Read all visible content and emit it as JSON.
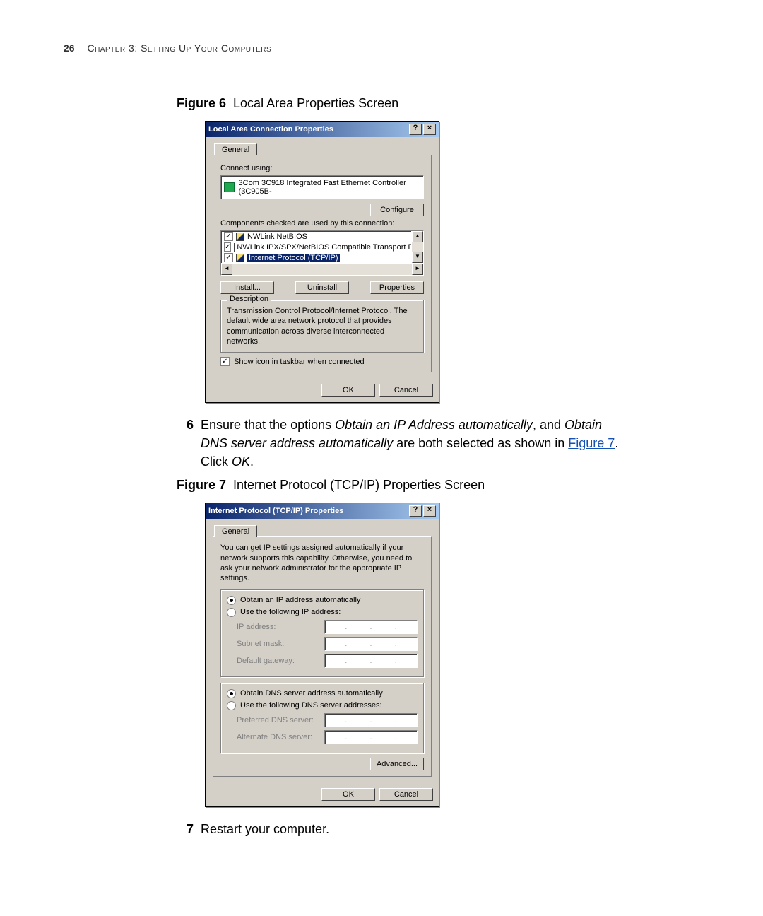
{
  "page": {
    "number": "26",
    "chapter": "Chapter 3: Setting Up Your Computers"
  },
  "fig6": {
    "label": "Figure 6",
    "caption": "Local Area Properties Screen"
  },
  "dlg1": {
    "title": "Local Area Connection Properties",
    "help": "?",
    "close": "×",
    "tab": "General",
    "connect_using": "Connect using:",
    "adapter": "3Com 3C918 Integrated Fast Ethernet Controller (3C905B-",
    "configure": "Configure",
    "components_label": "Components checked are used by this connection:",
    "items": [
      "NWLink NetBIOS",
      "NWLink IPX/SPX/NetBIOS Compatible Transport Proto",
      "Internet Protocol (TCP/IP)"
    ],
    "install": "Install...",
    "uninstall": "Uninstall",
    "properties": "Properties",
    "description_legend": "Description",
    "description": "Transmission Control Protocol/Internet Protocol. The default wide area network protocol that provides communication across diverse interconnected networks.",
    "show_icon": "Show icon in taskbar when connected",
    "ok": "OK",
    "cancel": "Cancel"
  },
  "step6": {
    "num": "6",
    "t1": "Ensure that the options ",
    "i1": "Obtain an IP Address automatically",
    "t2": ", and ",
    "i2": "Obtain DNS server address automatically",
    "t3": " are both selected as shown in ",
    "link": "Figure 7",
    "t4": ". Click ",
    "i3": "OK",
    "t5": "."
  },
  "fig7": {
    "label": "Figure 7",
    "caption": "Internet Protocol (TCP/IP) Properties Screen"
  },
  "dlg2": {
    "title": "Internet Protocol (TCP/IP) Properties",
    "help": "?",
    "close": "×",
    "tab": "General",
    "intro": "You can get IP settings assigned automatically if your network supports this capability. Otherwise, you need to ask your network administrator for the appropriate IP settings.",
    "r_obtain_ip": "Obtain an IP address automatically",
    "r_use_ip": "Use the following IP address:",
    "f_ip": "IP address:",
    "f_subnet": "Subnet mask:",
    "f_gateway": "Default gateway:",
    "r_obtain_dns": "Obtain DNS server address automatically",
    "r_use_dns": "Use the following DNS server addresses:",
    "f_pref_dns": "Preferred DNS server:",
    "f_alt_dns": "Alternate DNS server:",
    "advanced": "Advanced...",
    "ok": "OK",
    "cancel": "Cancel"
  },
  "step7": {
    "num": "7",
    "text": "Restart your computer."
  }
}
